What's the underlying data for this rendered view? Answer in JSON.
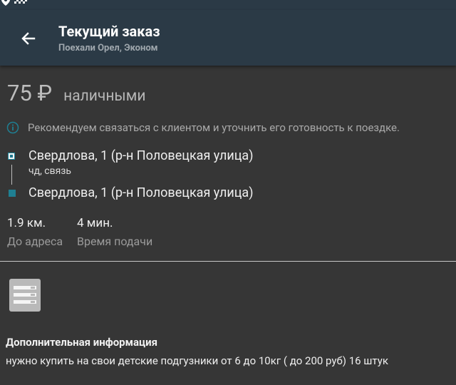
{
  "header": {
    "title": "Текущий заказ",
    "subtitle": "Поехали Орел, Эконом"
  },
  "order": {
    "price": "75 ₽",
    "payment": "наличными",
    "hint": "Рекомендуем связаться с клиентом и уточнить его готовность к поездке."
  },
  "route": {
    "from": "Свердлова, 1 (р-н Половецкая улица)",
    "from_comment": "чд, связь",
    "to": "Свердлова, 1 (р-н Половецкая улица)"
  },
  "stats": [
    {
      "value": "1.9 км.",
      "caption": "До адреса"
    },
    {
      "value": "4 мин.",
      "caption": "Время подачи"
    }
  ],
  "extra": {
    "title": "Дополнительная информация",
    "text": "нужно купить на свои детские подгузники от 6 до 10кг ( до 200 руб) 16 штук"
  },
  "colors": {
    "toolbar": "#2b3a46",
    "background": "#363636",
    "accent": "#1f7f92"
  },
  "icons": [
    "map-pin-icon",
    "checker-icon",
    "back-arrow-icon",
    "info-icon",
    "list-icon"
  ]
}
